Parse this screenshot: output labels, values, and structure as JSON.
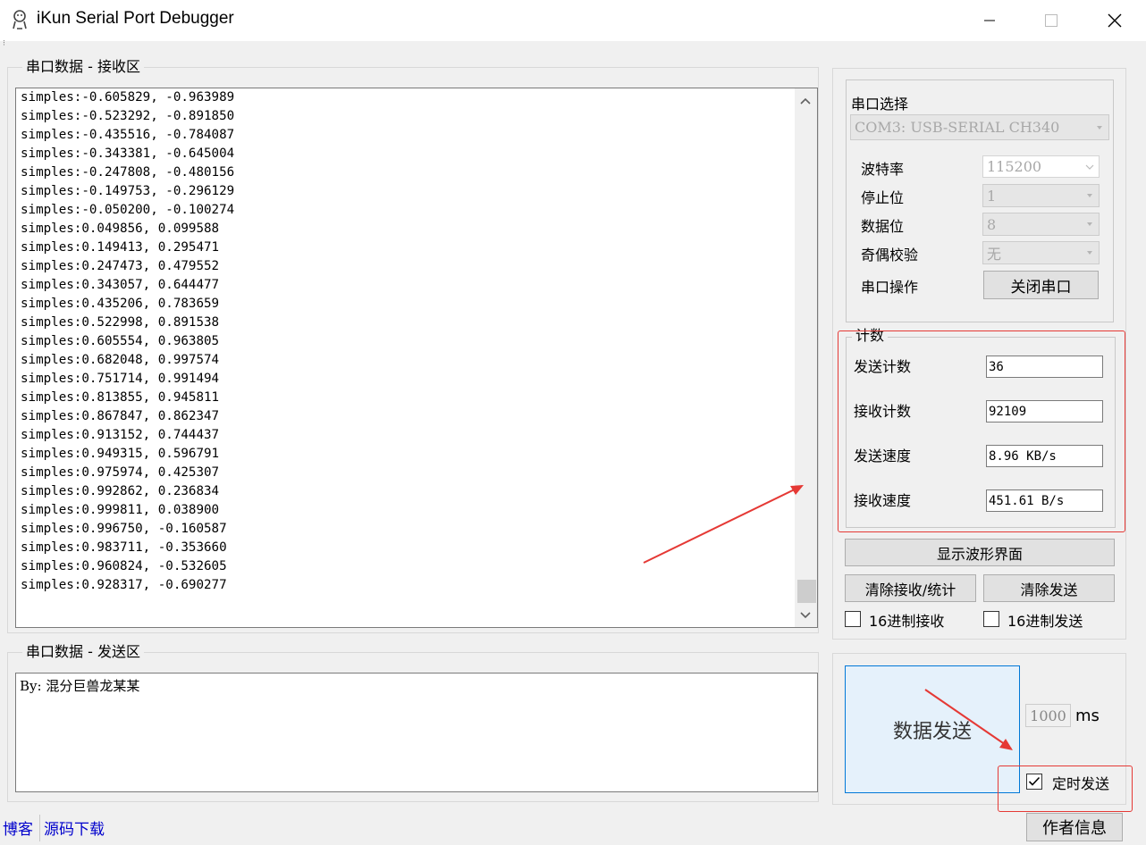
{
  "window": {
    "title": "iKun Serial Port Debugger"
  },
  "receive": {
    "legend": "串口数据 - 接收区",
    "lines": [
      "simples:-0.605829, -0.963989",
      "simples:-0.523292, -0.891850",
      "simples:-0.435516, -0.784087",
      "simples:-0.343381, -0.645004",
      "simples:-0.247808, -0.480156",
      "simples:-0.149753, -0.296129",
      "simples:-0.050200, -0.100274",
      "simples:0.049856, 0.099588",
      "simples:0.149413, 0.295471",
      "simples:0.247473, 0.479552",
      "simples:0.343057, 0.644477",
      "simples:0.435206, 0.783659",
      "simples:0.522998, 0.891538",
      "simples:0.605554, 0.963805",
      "simples:0.682048, 0.997574",
      "simples:0.751714, 0.991494",
      "simples:0.813855, 0.945811",
      "simples:0.867847, 0.862347",
      "simples:0.913152, 0.744437",
      "simples:0.949315, 0.596791",
      "simples:0.975974, 0.425307",
      "simples:0.992862, 0.236834",
      "simples:0.999811, 0.038900",
      "simples:0.996750, -0.160587",
      "simples:0.983711, -0.353660",
      "simples:0.960824, -0.532605",
      "simples:0.928317, -0.690277"
    ]
  },
  "send": {
    "legend": "串口数据 - 发送区",
    "text": "By: 混分巨兽龙某某"
  },
  "port": {
    "legend": "串口选择",
    "selected": "COM3: USB-SERIAL CH340",
    "baud_label": "波特率",
    "baud": "115200",
    "stop_label": "停止位",
    "stop": "1",
    "data_label": "数据位",
    "data_bits": "8",
    "parity_label": "奇偶校验",
    "parity": "无",
    "op_label": "串口操作",
    "op_button": "关闭串口"
  },
  "counts": {
    "legend": "计数",
    "send_count_label": "发送计数",
    "send_count": "36",
    "recv_count_label": "接收计数",
    "recv_count": "92109",
    "send_speed_label": "发送速度",
    "send_speed": "8.96 KB/s",
    "recv_speed_label": "接收速度",
    "recv_speed": "451.61 B/s"
  },
  "actions": {
    "show_wave": "显示波形界面",
    "clear_recv": "清除接收/统计",
    "clear_send": "清除发送",
    "hex_recv": "16进制接收",
    "hex_send": "16进制发送"
  },
  "sendbox": {
    "send_button": "数据发送",
    "interval": "1000",
    "interval_unit": "ms",
    "timed_send": "定时发送",
    "timed_send_checked": true
  },
  "footer": {
    "blog": "博客",
    "source": "源码下载",
    "author": "作者信息"
  },
  "colors": {
    "annotation": "#e53935",
    "send_button_bg": "#e5f1fb",
    "send_button_border": "#0078d7",
    "link": "#0000cc"
  }
}
